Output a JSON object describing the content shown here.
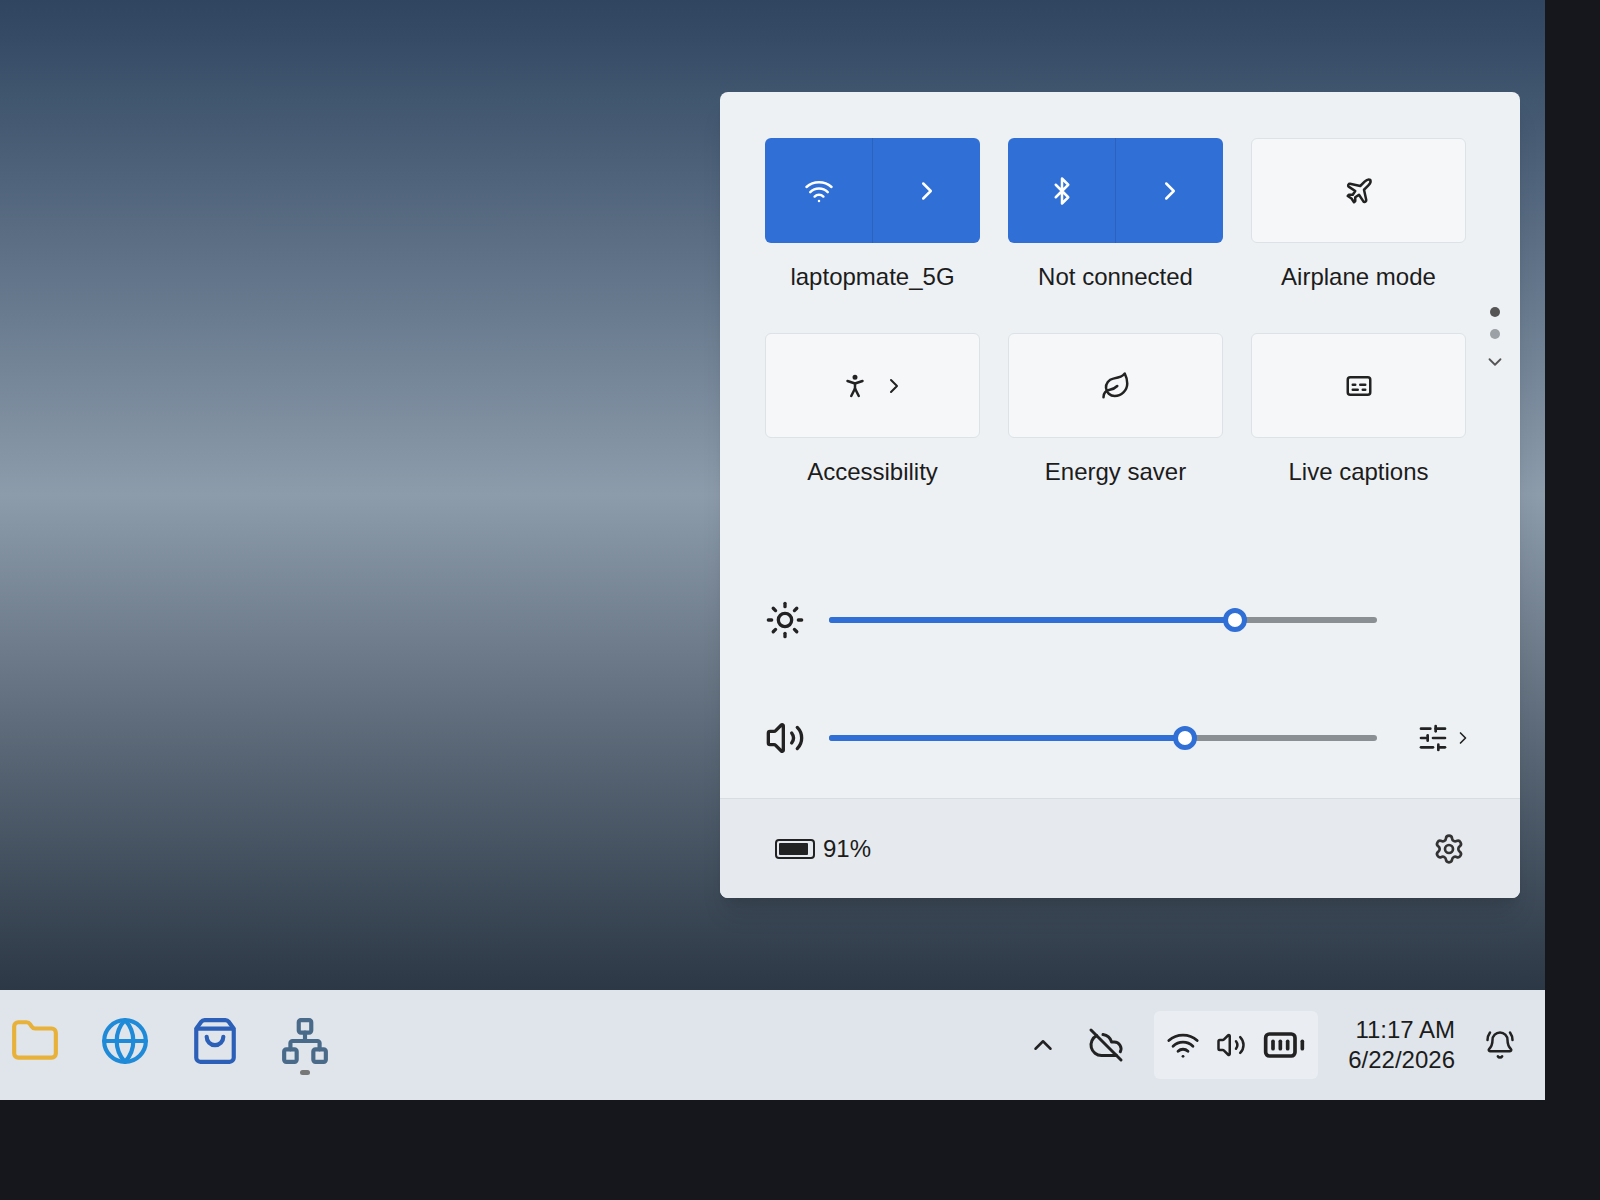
{
  "quick_settings": {
    "tiles": [
      {
        "label": "laptopmate_5G",
        "on": true,
        "expandable": true
      },
      {
        "label": "Not connected",
        "on": true,
        "expandable": true
      },
      {
        "label": "Airplane mode",
        "on": false,
        "expandable": false
      },
      {
        "label": "Accessibility",
        "on": false,
        "expandable": true
      },
      {
        "label": "Energy saver",
        "on": false,
        "expandable": false
      },
      {
        "label": "Live captions",
        "on": false,
        "expandable": false
      }
    ],
    "pages": [
      {
        "selected": true
      },
      {
        "selected": false
      }
    ],
    "sliders": [
      {
        "level": 0.74,
        "expandable": false
      },
      {
        "level": 0.65,
        "expandable": true
      }
    ],
    "battery": {
      "reading": "91%",
      "level": 0.91
    }
  },
  "taskbar": {
    "apps": [
      {
        "active": false
      },
      {
        "active": false
      },
      {
        "active": false
      },
      {
        "active": true
      }
    ],
    "clock": {
      "time": "11:17 AM",
      "date": "6/22/2026"
    }
  }
}
